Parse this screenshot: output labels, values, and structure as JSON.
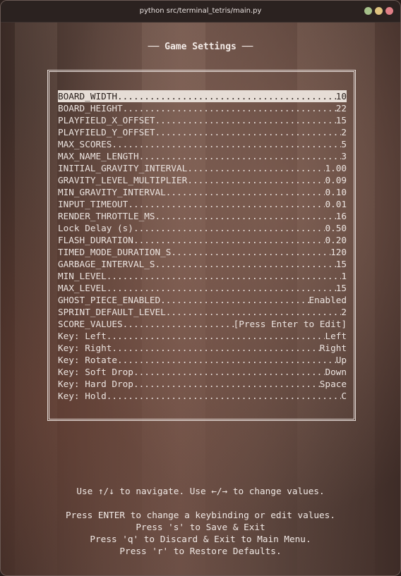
{
  "window": {
    "title": "python src/terminal_tetris/main.py",
    "controls": [
      "green",
      "yellow",
      "red"
    ],
    "control_colors": {
      "green": "#a6c08a",
      "yellow": "#e0c37f",
      "red": "#e07f86"
    }
  },
  "heading": "── Game Settings ──",
  "settings": [
    {
      "name": "BOARD_WIDTH",
      "value": "10",
      "selected": true
    },
    {
      "name": "BOARD_HEIGHT",
      "value": "22"
    },
    {
      "name": "PLAYFIELD_X_OFFSET",
      "value": "15"
    },
    {
      "name": "PLAYFIELD_Y_OFFSET",
      "value": "2"
    },
    {
      "name": "MAX_SCORES",
      "value": "5"
    },
    {
      "name": "MAX_NAME_LENGTH",
      "value": "3"
    },
    {
      "name": "INITIAL_GRAVITY_INTERVAL",
      "value": "1.00"
    },
    {
      "name": "GRAVITY_LEVEL_MULTIPLIER",
      "value": "0.09"
    },
    {
      "name": "MIN_GRAVITY_INTERVAL",
      "value": "0.10"
    },
    {
      "name": "INPUT_TIMEOUT",
      "value": "0.01"
    },
    {
      "name": "RENDER_THROTTLE_MS",
      "value": "16"
    },
    {
      "name": "Lock Delay (s)",
      "value": "0.50"
    },
    {
      "name": "FLASH_DURATION",
      "value": "0.20"
    },
    {
      "name": "TIMED_MODE_DURATION_S",
      "value": "120"
    },
    {
      "name": "GARBAGE_INTERVAL_S",
      "value": "15"
    },
    {
      "name": "MIN_LEVEL",
      "value": "1"
    },
    {
      "name": "MAX_LEVEL",
      "value": "15"
    },
    {
      "name": "GHOST_PIECE_ENABLED",
      "value": "Enabled"
    },
    {
      "name": "SPRINT_DEFAULT_LEVEL",
      "value": "2"
    },
    {
      "name": "SCORE_VALUES",
      "value": "[Press Enter to Edit]"
    },
    {
      "name": "Key: Left",
      "value": "Left"
    },
    {
      "name": "Key: Right",
      "value": "Right"
    },
    {
      "name": "Key: Rotate",
      "value": "Up"
    },
    {
      "name": "Key: Soft Drop",
      "value": "Down"
    },
    {
      "name": "Key: Hard Drop",
      "value": "Space"
    },
    {
      "name": "Key: Hold",
      "value": "C"
    }
  ],
  "help": {
    "navigate": "Use ↑/↓ to navigate. Use ←/→ to change values.",
    "enter": "Press ENTER to change a keybinding or edit values.",
    "save": "Press 's' to Save & Exit",
    "discard": "Press 'q' to Discard & Exit to Main Menu.",
    "restore": "Press 'r' to Restore Defaults."
  },
  "colors": {
    "text": "#ece4e0",
    "selected_bg": "#e6ddd6",
    "selected_text": "#2a201c"
  }
}
